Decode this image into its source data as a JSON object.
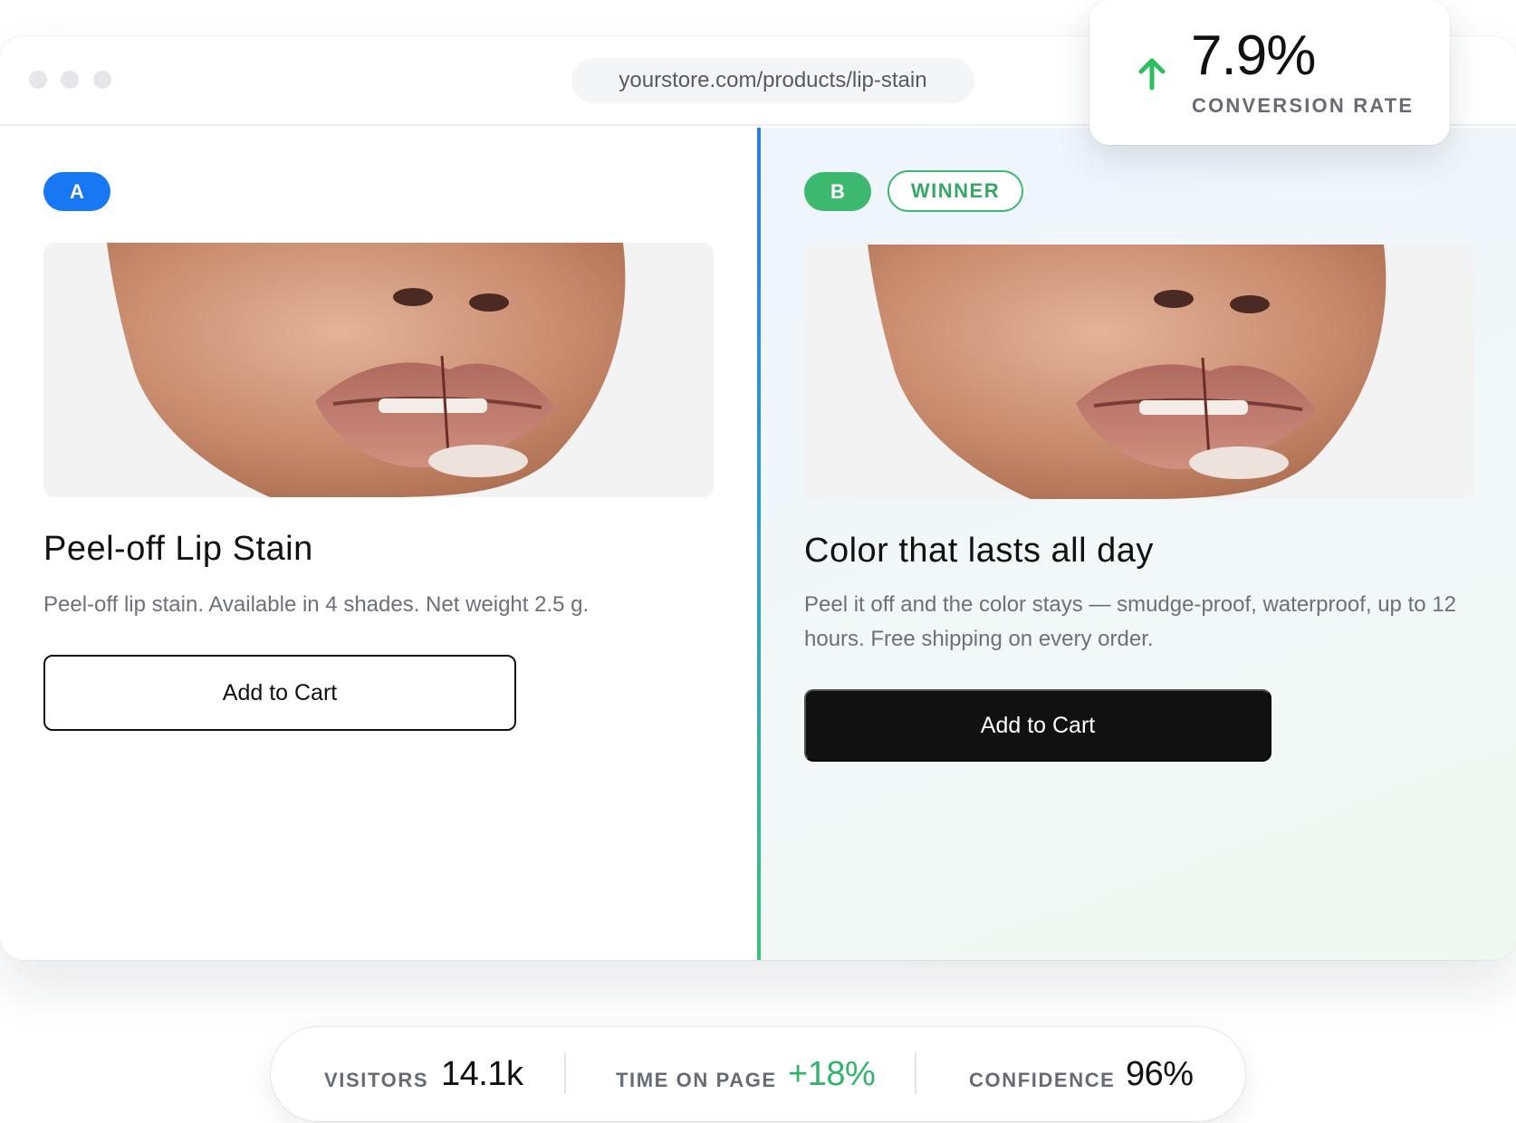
{
  "browser": {
    "url": "yourstore.com/products/lip-stain"
  },
  "conversion": {
    "value": "7.9%",
    "label": "CONVERSION RATE",
    "trend_icon": "arrow-up-icon",
    "trend_color": "#2bbf5e"
  },
  "variant_a": {
    "badge": "A",
    "badge_color": "#1877f2",
    "image_description": "close-up of lips with peel-off lip stain",
    "title": "Peel-off Lip Stain",
    "description": "Peel-off lip stain. Available in 4 shades. Net weight 2.5 g.",
    "cta": "Add to Cart"
  },
  "variant_b": {
    "badge": "B",
    "badge_color": "#3cb96f",
    "winner_label": "WINNER",
    "title": "Color that lasts all day",
    "description": "Peel it off and the color stays — smudge-proof, waterproof, up to 12 hours. Free shipping on every order.",
    "cta": "Add to Cart"
  },
  "stats": {
    "visitors_label": "VISITORS",
    "visitors_value": "14.1k",
    "time_label": "TIME ON PAGE",
    "time_value": "+18%",
    "confidence_label": "CONFIDENCE",
    "confidence_value": "96%"
  }
}
